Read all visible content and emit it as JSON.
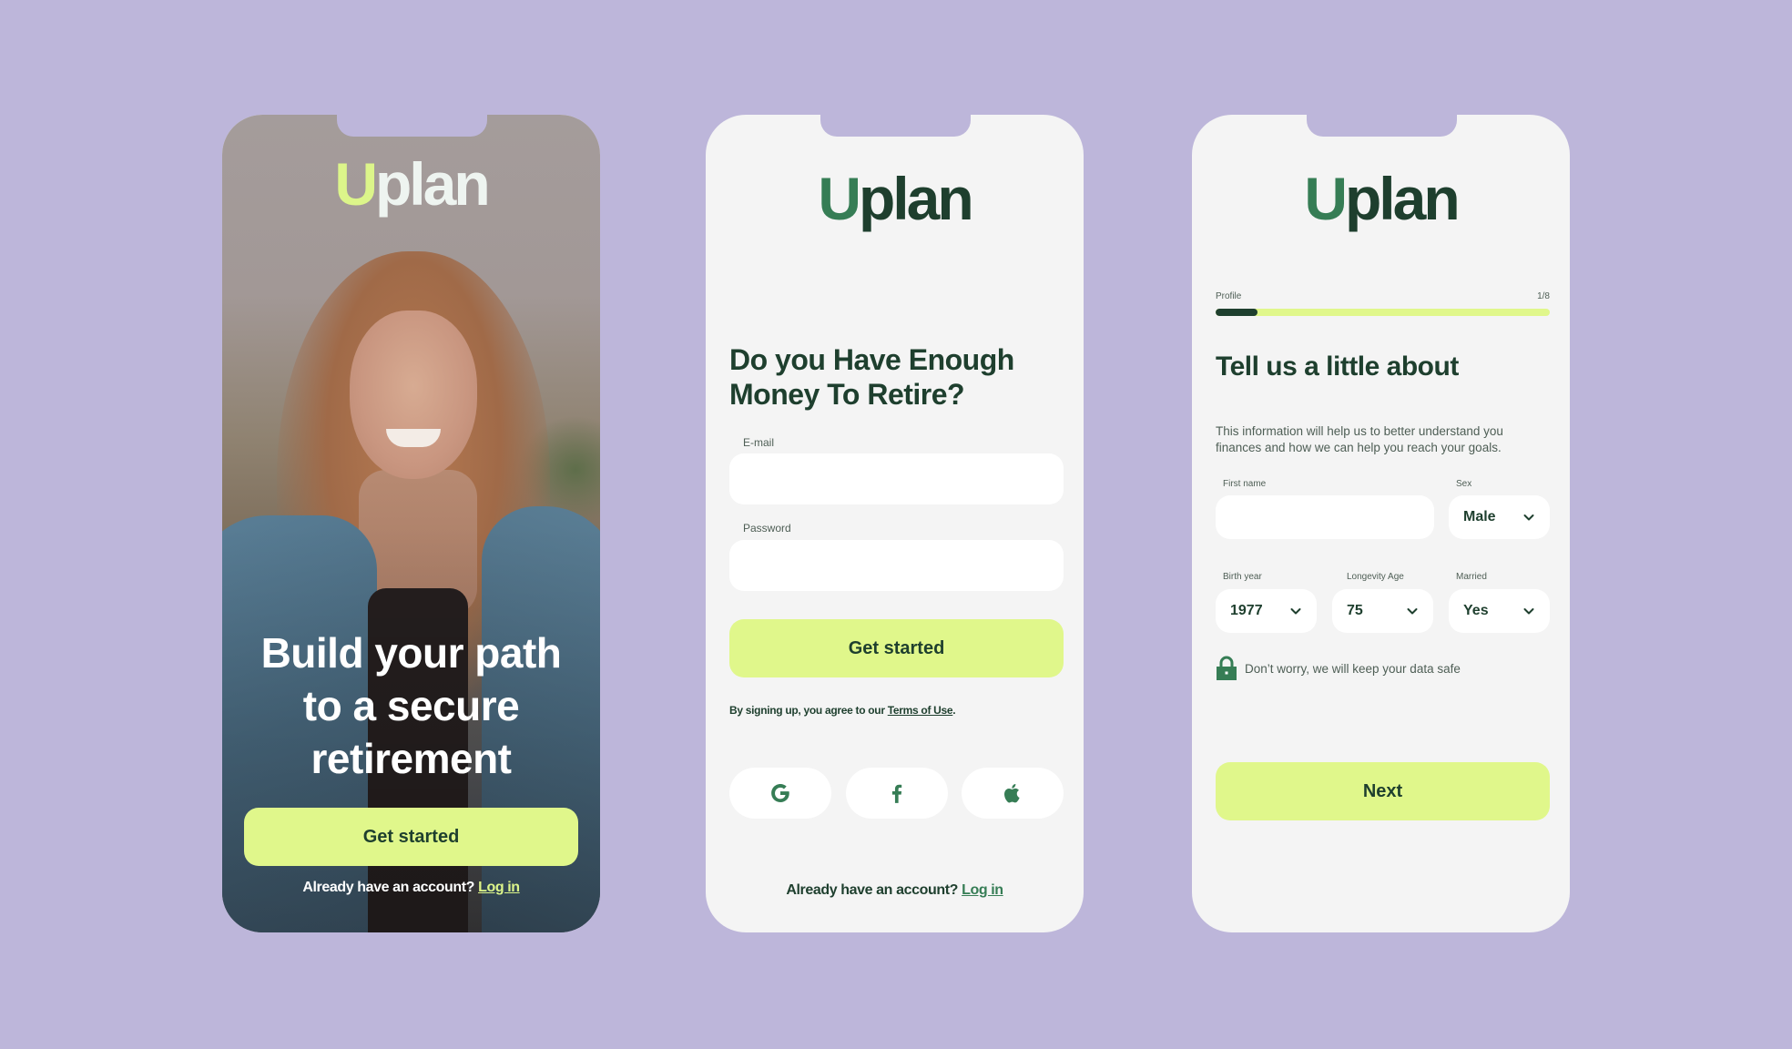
{
  "colors": {
    "background": "#bdb6da",
    "brand_dark": "#1e3f2e",
    "brand_green": "#367d55",
    "accent_lime": "#e0f78b",
    "screen_bg": "#f4f4f4"
  },
  "brand": {
    "logo_first": "U",
    "logo_rest": "plan"
  },
  "welcome": {
    "title": "Build your path\nto a secure\nretirement",
    "primary_button": "Get started",
    "login_prompt": "Already have an account? ",
    "login_link": "Log in"
  },
  "signup": {
    "title": "Do you Have Enough\nMoney To Retire?",
    "email_label": "E-mail",
    "email_value": "",
    "password_label": "Password",
    "password_value": "",
    "primary_button": "Get started",
    "terms_prefix": "By signing up, you agree to our ",
    "terms_link": "Terms of Use",
    "terms_suffix": ".",
    "social": [
      {
        "name": "google",
        "icon": "google-icon"
      },
      {
        "name": "facebook",
        "icon": "facebook-icon"
      },
      {
        "name": "apple",
        "icon": "apple-icon"
      }
    ],
    "login_prompt": "Already have an account? ",
    "login_link": "Log in"
  },
  "profile": {
    "progress_label": "Profile",
    "progress_count": "1/8",
    "progress_fraction": 0.125,
    "title": "Tell us a little about",
    "description": "This information will help us to better understand you finances and how we can help you reach your goals.",
    "first_name_label": "First name",
    "first_name_value": "",
    "sex_label": "Sex",
    "sex_value": "Male",
    "birth_year_label": "Birth year",
    "birth_year_value": "1977",
    "longevity_label": "Longevity Age",
    "longevity_value": "75",
    "married_label": "Married",
    "married_value": "Yes",
    "safe_note": "Don’t worry, we will keep your data safe",
    "next_button": "Next"
  }
}
